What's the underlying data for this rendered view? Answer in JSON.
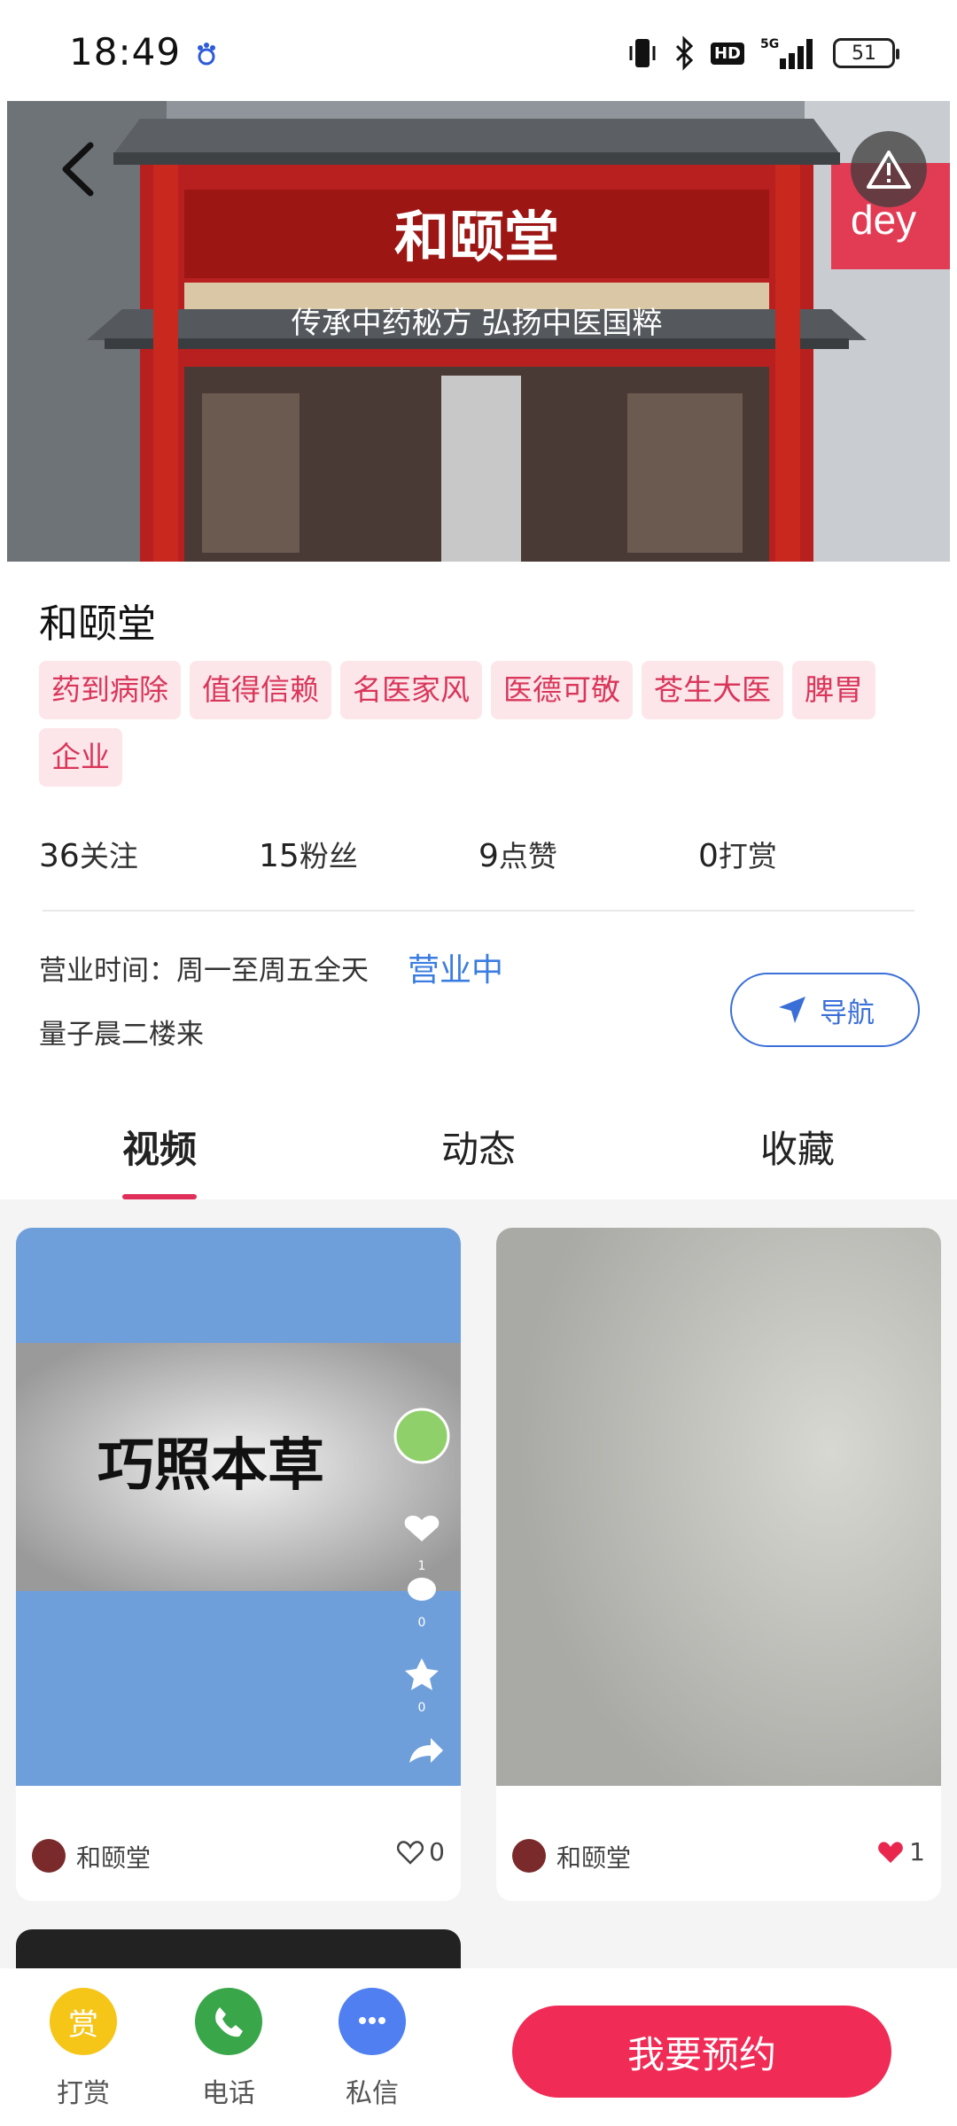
{
  "status_bar": {
    "time": "18:49",
    "network": "5G",
    "hd": "HD",
    "battery": "51",
    "icons": [
      "baidu-icon",
      "vibrate-icon",
      "bluetooth-icon",
      "signal-icon",
      "battery-icon"
    ]
  },
  "hero": {
    "storefront_sign": "和颐堂",
    "storefront_banner": "传承中药秘方 弘扬中医国粹",
    "icons": [
      "back-arrow-icon",
      "warning-icon"
    ]
  },
  "shop": {
    "name": "和颐堂",
    "tags": [
      "药到病除",
      "值得信赖",
      "名医家风",
      "医德可敬",
      "苍生大医",
      "脾胃",
      "企业"
    ],
    "stats": [
      {
        "num": "36",
        "label": "关注"
      },
      {
        "num": "15",
        "label": "粉丝"
      },
      {
        "num": "9",
        "label": "点赞"
      },
      {
        "num": "0",
        "label": "打赏"
      }
    ],
    "hours": "营业时间：周一至周五全天",
    "open_status": "营业中",
    "address": "量子晨二楼来",
    "nav_label": "导航"
  },
  "tabs": [
    {
      "label": "视频",
      "active": true
    },
    {
      "label": "动态",
      "active": false
    },
    {
      "label": "收藏",
      "active": false
    }
  ],
  "feed": [
    {
      "author": "和颐堂",
      "likes": "0",
      "liked": false,
      "thumb_text": "巧照本草",
      "side_counts": [
        "1",
        "0",
        "0"
      ]
    },
    {
      "author": "和颐堂",
      "likes": "1",
      "liked": true
    }
  ],
  "bottom_bar": {
    "items": [
      {
        "label": "打赏",
        "glyph": "赏",
        "color": "#f5c518"
      },
      {
        "label": "电话",
        "color": "#3aa64a"
      },
      {
        "label": "私信",
        "color": "#4f7ff0"
      }
    ],
    "book_label": "我要预约"
  },
  "colors": {
    "accent": "#f02b56",
    "tag_bg": "#fde6ea",
    "tag_text": "#d9365a",
    "link_blue": "#3b7ce0"
  }
}
